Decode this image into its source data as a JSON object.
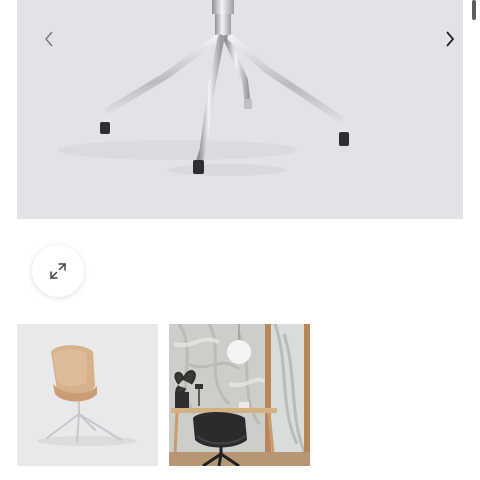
{
  "viewer": {
    "main_image": {
      "alt": "",
      "background": "#e3e2e6",
      "icons": {
        "prev": "chevron-left-icon",
        "next": "chevron-right-icon"
      }
    },
    "zoom": {
      "icon": "expand-arrows-icon"
    },
    "thumbnails": [
      {
        "id": "thumb-chair-beige",
        "selected": false
      },
      {
        "id": "thumb-chair-black-desk",
        "selected": false
      }
    ]
  },
  "colors": {
    "chrome": "#c9cacd",
    "chair_shell_beige": "#dcb795",
    "chair_shell_black": "#2b2b2d",
    "wood": "#c89a67"
  }
}
